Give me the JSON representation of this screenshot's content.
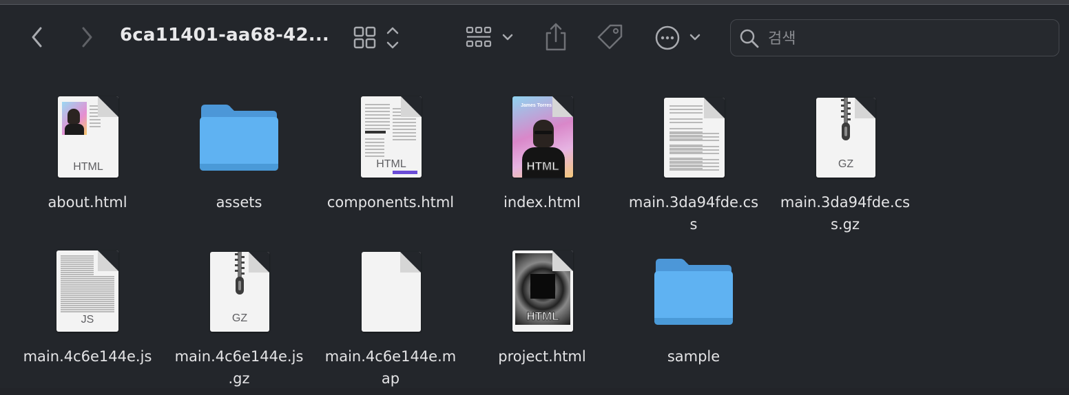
{
  "toolbar": {
    "title": "6ca11401-aa68-42...",
    "search_placeholder": "검색"
  },
  "files": [
    {
      "name": "about.html",
      "type": "HTML"
    },
    {
      "name": "assets",
      "type": "folder"
    },
    {
      "name": "components.html",
      "type": "HTML"
    },
    {
      "name": "index.html",
      "type": "HTML",
      "thumb_title": "James Torres"
    },
    {
      "name_line1": "main.3da94fde.cs",
      "name_line2": "s",
      "type": "css"
    },
    {
      "name_line1": "main.3da94fde.cs",
      "name_line2": "s.gz",
      "type": "GZ"
    },
    {
      "name": "main.4c6e144e.js",
      "type": "JS"
    },
    {
      "name_line1": "main.4c6e144e.js",
      "name_line2": ".gz",
      "type": "GZ"
    },
    {
      "name_line1": "main.4c6e144e.m",
      "name_line2": "ap",
      "type": "map"
    },
    {
      "name": "project.html",
      "type": "HTML"
    },
    {
      "name": "sample",
      "type": "folder"
    }
  ],
  "colors": {
    "background": "#23262b",
    "folder": "#5aaef0",
    "text": "#e4e4e6"
  }
}
